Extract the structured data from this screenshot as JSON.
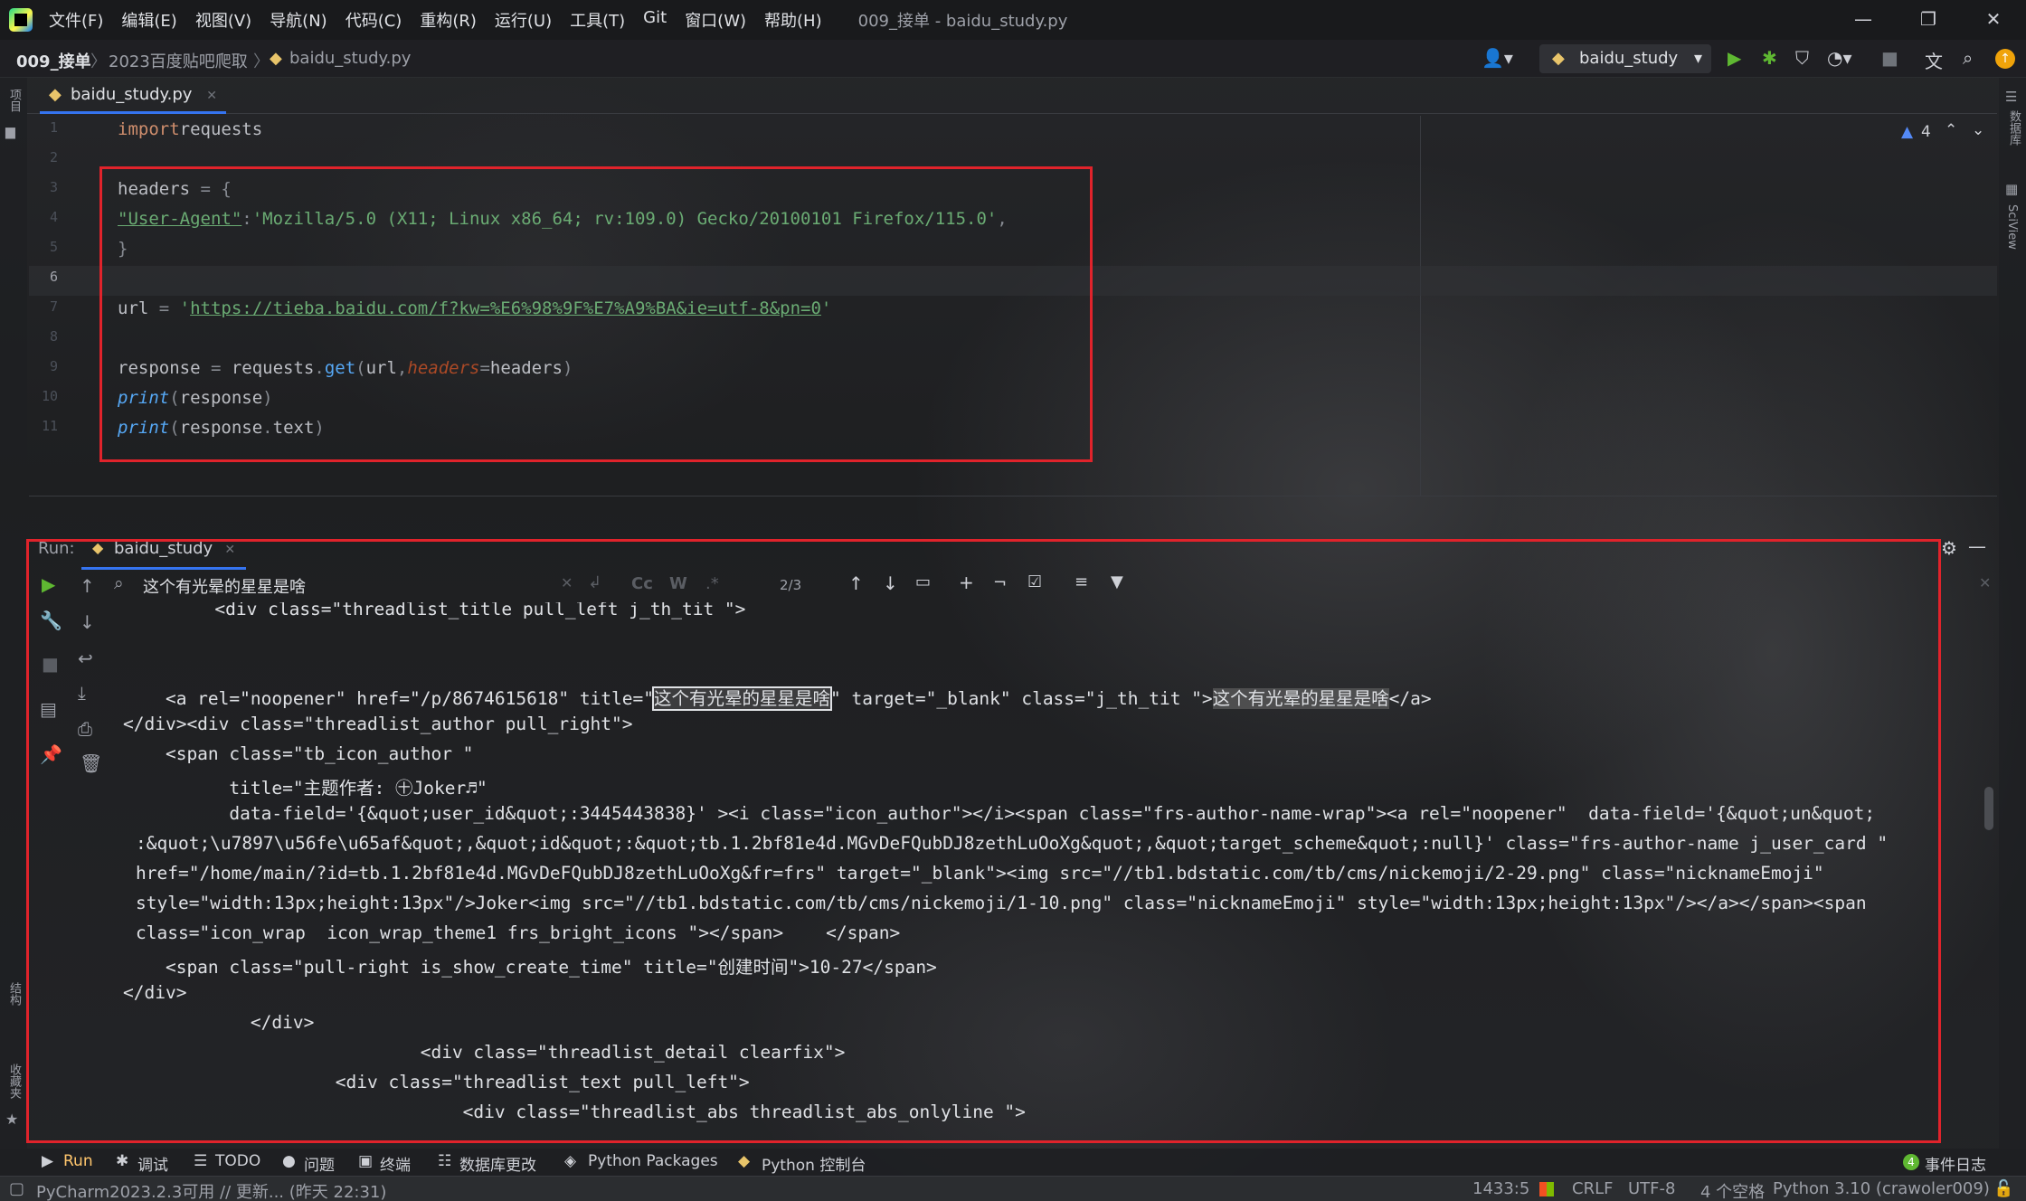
{
  "menu": [
    "文件(F)",
    "编辑(E)",
    "视图(V)",
    "导航(N)",
    "代码(C)",
    "重构(R)",
    "运行(U)",
    "工具(T)",
    "Git",
    "窗口(W)",
    "帮助(H)"
  ],
  "window_title": "009_接单 - baidu_study.py",
  "breadcrumb": {
    "project": "009_接单",
    "folder": "2023百度贴吧爬取",
    "file": "baidu_study.py"
  },
  "run_config": "baidu_study",
  "editor_tab": "baidu_study.py",
  "warnings": "4",
  "left_strip": {
    "project": "项目",
    "structure": "结构",
    "bookmarks": "收藏夹"
  },
  "right_strip": {
    "db": "数据库",
    "sciview": "SciView"
  },
  "code_lines": [
    {
      "n": "1",
      "t": [
        [
          "kw",
          "import"
        ],
        [
          "",
          "requests"
        ]
      ]
    },
    {
      "n": "2",
      "t": []
    },
    {
      "n": "3",
      "t": [
        [
          "",
          "headers "
        ],
        [
          "gy",
          "= {"
        ]
      ]
    },
    {
      "n": "4",
      "t": [
        [
          "strurl",
          "\"User-Agent\""
        ],
        [
          "gy",
          ":"
        ],
        [
          "str",
          "'Mozilla/5.0 (X11; Linux x86_64; rv:109.0) Gecko/20100101 Firefox/115.0'"
        ],
        [
          "gy",
          ","
        ]
      ]
    },
    {
      "n": "5",
      "t": [
        [
          "gy",
          "}"
        ]
      ]
    },
    {
      "n": "6",
      "t": []
    },
    {
      "n": "7",
      "t": [
        [
          "",
          "url "
        ],
        [
          "gy",
          "= "
        ],
        [
          "str",
          "'"
        ],
        [
          "strurl",
          "https://tieba.baidu.com/f?kw=%E6%98%9F%E7%A9%BA&ie=utf-8&pn=0"
        ],
        [
          "str",
          "'"
        ]
      ]
    },
    {
      "n": "8",
      "t": []
    },
    {
      "n": "9",
      "t": [
        [
          "",
          "response "
        ],
        [
          "gy",
          "= "
        ],
        [
          "",
          "requests"
        ],
        [
          "gy",
          "."
        ],
        [
          "fn",
          "get"
        ],
        [
          "gy",
          "("
        ],
        [
          "",
          "url"
        ],
        [
          "gy",
          ","
        ],
        [
          "param",
          "headers"
        ],
        [
          "gy",
          "="
        ],
        [
          "",
          "headers"
        ],
        [
          "gy",
          ")"
        ]
      ]
    },
    {
      "n": "10",
      "t": [
        [
          "it",
          "print"
        ],
        [
          "gy",
          "("
        ],
        [
          "",
          "response"
        ],
        [
          "gy",
          ")"
        ]
      ]
    },
    {
      "n": "11",
      "t": [
        [
          "it",
          "print"
        ],
        [
          "gy",
          "("
        ],
        [
          "",
          "response"
        ],
        [
          "gy",
          "."
        ],
        [
          "",
          "text"
        ],
        [
          "gy",
          ")"
        ]
      ]
    }
  ],
  "run": {
    "label": "Run:",
    "tab": "baidu_study",
    "search_value": "这个有光晕的星星是啥",
    "match_count": "2/3"
  },
  "console": {
    "line0": "          <div class=\"threadlist_title pull_left j_th_tit \">",
    "line1a": "    <a rel=\"noopener\" href=\"/p/8674615618\" title=\"",
    "hl": "这个有光晕的星星是啥",
    "line1b": "\" target=\"_blank\" class=\"j_th_tit \">",
    "line1c": "</a>",
    "line2": "</div><div class=\"threadlist_author pull_right\">",
    "line3": "    <span class=\"tb_icon_author \"",
    "line4": "          title=\"主题作者: ㊉Joker♬\"",
    "line5": "          data-field='{&quot;user_id&quot;:3445443838}' ><i class=\"icon_author\"></i><span class=\"frs-author-name-wrap\"><a rel=\"noopener\"  data-field='{&quot;un&quot;",
    "line6": ":&quot;\\u7897\\u56fe\\u65af&quot;,&quot;id&quot;:&quot;tb.1.2bf81e4d.MGvDeFQubDJ8zethLuOoXg&quot;,&quot;target_scheme&quot;:null}' class=\"frs-author-name j_user_card \"",
    "line7": "href=\"/home/main/?id=tb.1.2bf81e4d.MGvDeFQubDJ8zethLuOoXg&fr=frs\" target=\"_blank\"><img src=\"//tb1.bdstatic.com/tb/cms/nickemoji/2-29.png\" class=\"nicknameEmoji\"",
    "line8": "style=\"width:13px;height:13px\"/>Joker<img src=\"//tb1.bdstatic.com/tb/cms/nickemoji/1-10.png\" class=\"nicknameEmoji\" style=\"width:13px;height:13px\"/></a></span><span",
    "line9": "class=\"icon_wrap  icon_wrap_theme1 frs_bright_icons \"></span>    </span>",
    "line10": "    <span class=\"pull-right is_show_create_time\" title=\"创建时间\">10-27</span>",
    "line11": "</div>",
    "line12": "            </div>",
    "line13": "                            <div class=\"threadlist_detail clearfix\">",
    "line14": "                    <div class=\"threadlist_text pull_left\">",
    "line15": "                                <div class=\"threadlist_abs threadlist_abs_onlyline \">"
  },
  "bottom_tools": [
    "Run",
    "调试",
    "TODO",
    "问题",
    "终端",
    "数据库更改",
    "Python Packages",
    "Python 控制台"
  ],
  "event_log": {
    "count": "4",
    "label": "事件日志"
  },
  "status": {
    "message": "PyCharm2023.2.3可用 // 更新... (昨天 22:31)",
    "position": "1433:5",
    "line_sep": "CRLF",
    "encoding": "UTF-8",
    "indent": "4 个空格",
    "interpreter": "Python 3.10 (crawoler009)"
  },
  "colors": {
    "highlight_box": "#e0232b",
    "accent": "#3574f0",
    "run_green": "#5fb832"
  }
}
